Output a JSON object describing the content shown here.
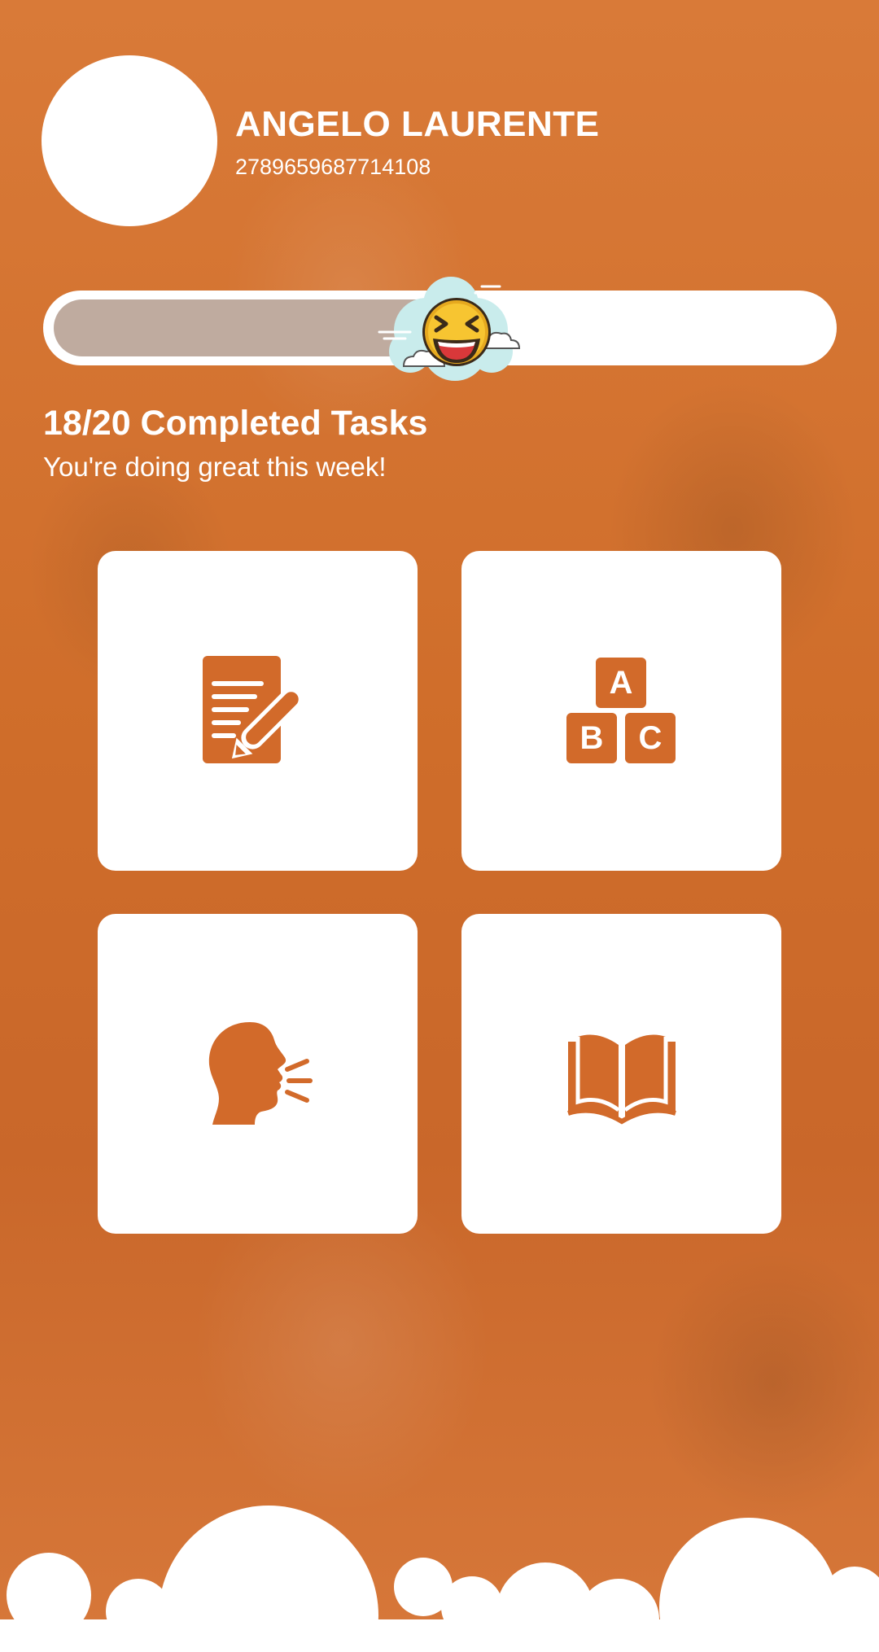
{
  "profile": {
    "name": "ANGELO LAURENTE",
    "id": "2789659687714108"
  },
  "progress": {
    "completed": 18,
    "total": 20,
    "fraction": 0.51,
    "marker_icon": "laughing-emoji-cloud-icon"
  },
  "tasks": {
    "title": "18/20 Completed Tasks",
    "subtitle": "You're doing great this week!"
  },
  "tiles": [
    {
      "icon": "writing-pencil-icon"
    },
    {
      "icon": "abc-blocks-icon",
      "block_letters": [
        "A",
        "B",
        "C"
      ]
    },
    {
      "icon": "speaking-head-icon"
    },
    {
      "icon": "open-book-icon"
    }
  ],
  "colors": {
    "accent": "#d26a2a",
    "background": "#d4722f",
    "progress_fill": "#bfab9f",
    "card": "#ffffff",
    "emoji_face": "#f7c531",
    "emoji_cloud": "#c9ecec"
  }
}
